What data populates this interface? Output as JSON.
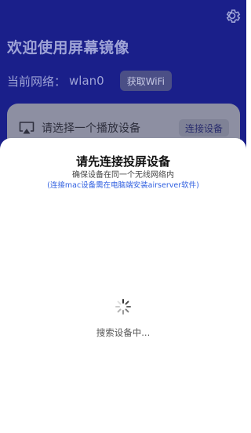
{
  "app": {
    "title": "欢迎使用屏幕镜像",
    "network_label": "当前网络：",
    "network_value": "wlan0",
    "get_wifi_button": "获取WiFi",
    "settings_icon": "gear-icon"
  },
  "device_card": {
    "icon": "cast-icon",
    "prompt": "请选择一个播放设备",
    "connect_button": "连接设备"
  },
  "sheet": {
    "title": "请先连接投屏设备",
    "subtitle": "确保设备在同一个无线网络内",
    "hint": "(连接mac设备需在电脑端安装airserver软件)",
    "status": "搜索设备中...",
    "spinner_icon": "loading-spinner-icon"
  },
  "colors": {
    "background": "#1a1f8a",
    "hint_text": "#2f5fe0"
  }
}
